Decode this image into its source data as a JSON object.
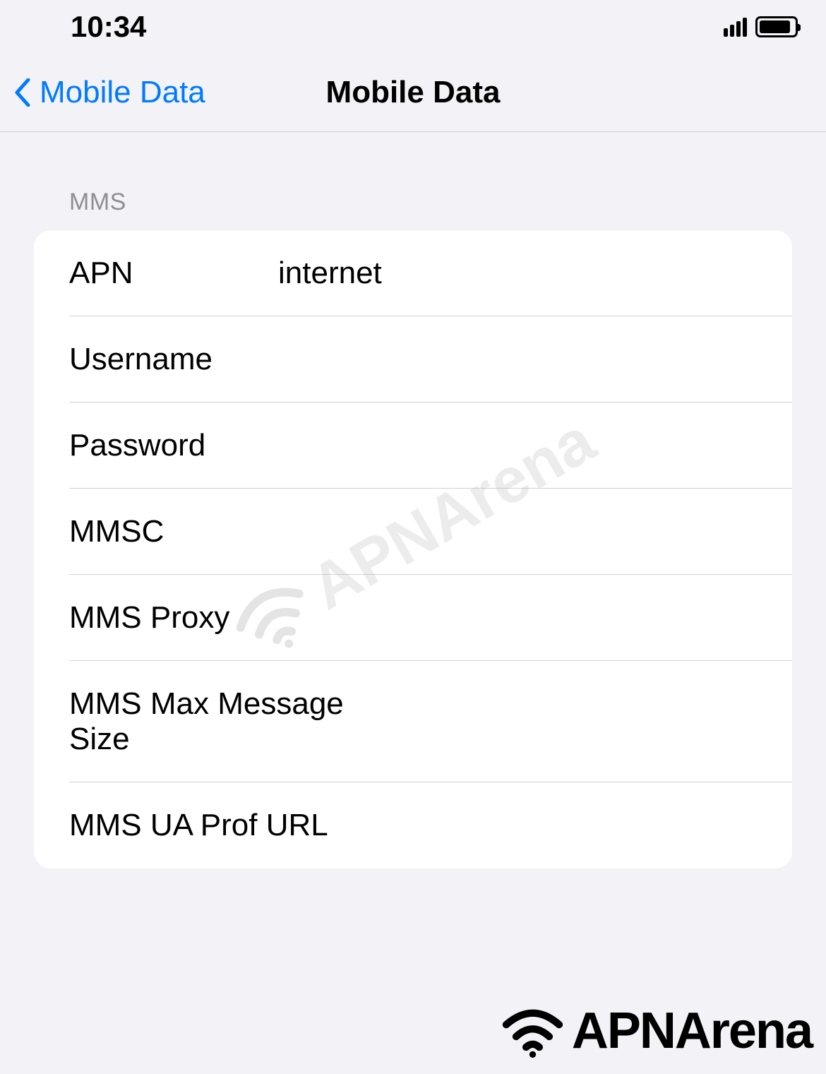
{
  "status_bar": {
    "time": "10:34"
  },
  "nav": {
    "back_label": "Mobile Data",
    "title": "Mobile Data"
  },
  "section": {
    "header": "MMS",
    "rows": [
      {
        "label": "APN",
        "value": "internet"
      },
      {
        "label": "Username",
        "value": ""
      },
      {
        "label": "Password",
        "value": ""
      },
      {
        "label": "MMSC",
        "value": ""
      },
      {
        "label": "MMS Proxy",
        "value": ""
      },
      {
        "label": "MMS Max Message Size",
        "value": ""
      },
      {
        "label": "MMS UA Prof URL",
        "value": ""
      }
    ]
  },
  "watermark": {
    "text": "APNArena"
  },
  "footer": {
    "text": "APNArena"
  }
}
